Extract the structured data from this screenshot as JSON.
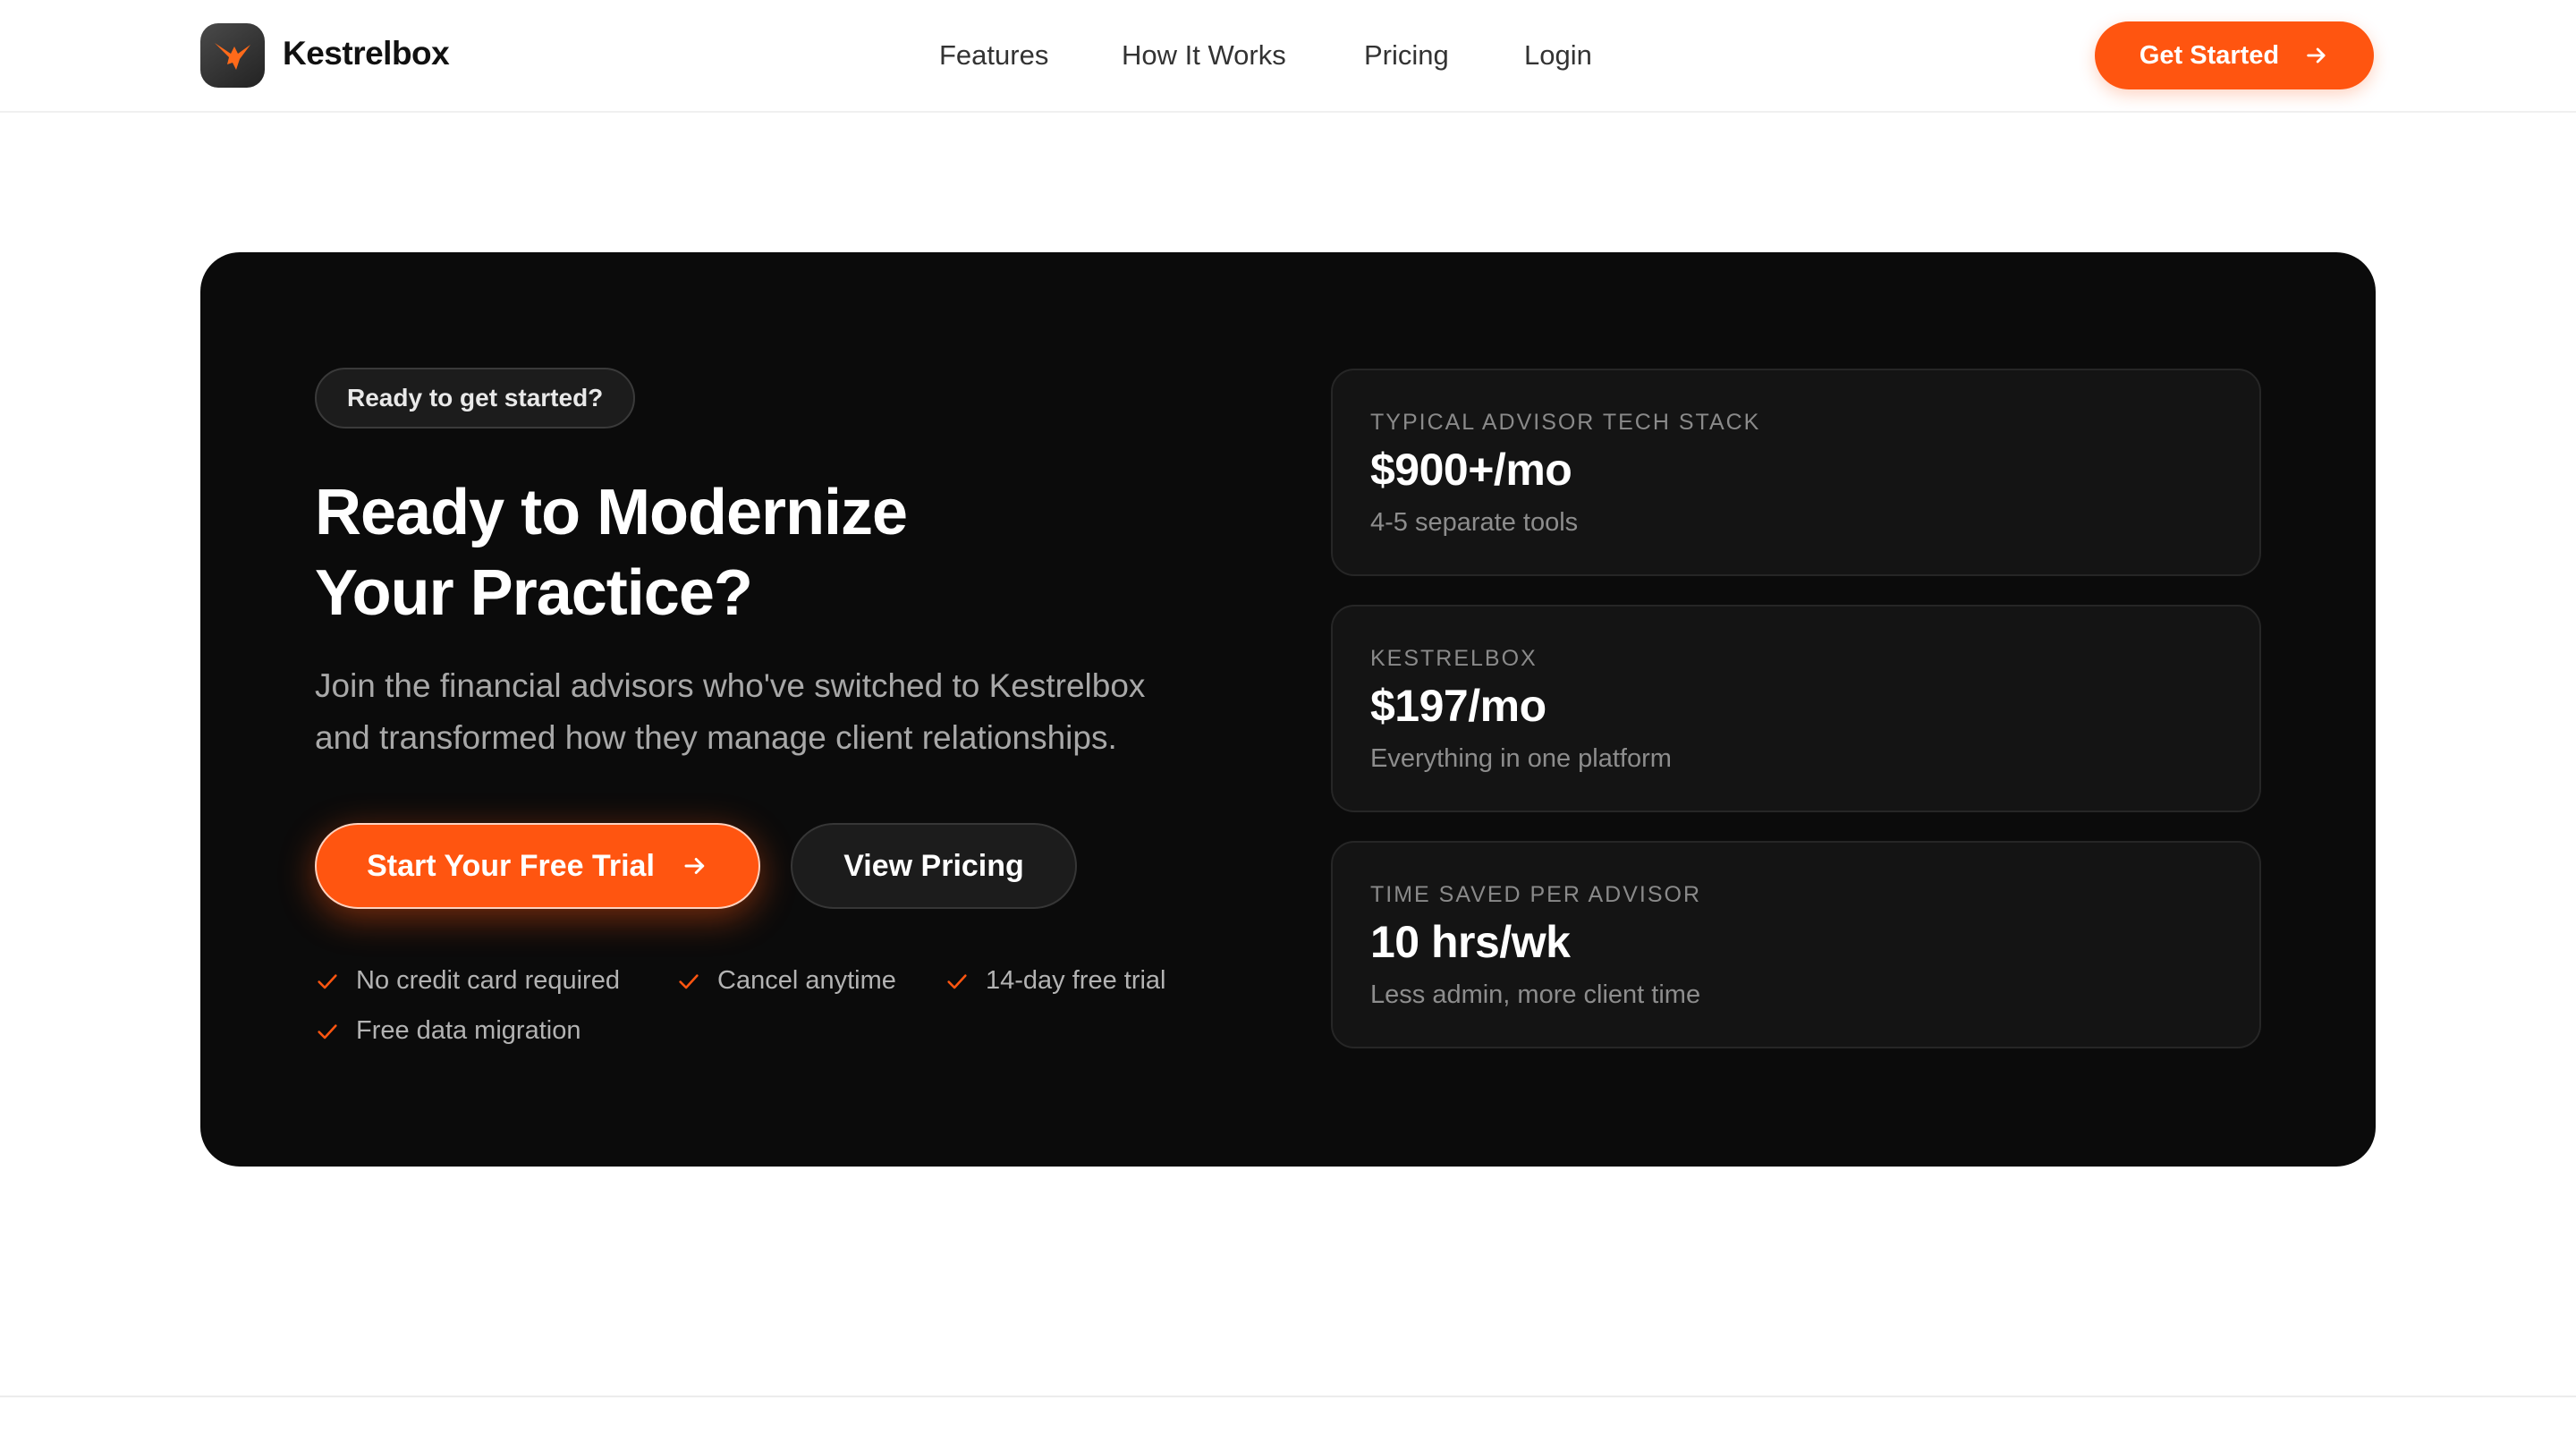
{
  "header": {
    "brand": "Kestrelbox",
    "nav": [
      "Features",
      "How It Works",
      "Pricing",
      "Login"
    ],
    "cta_label": "Get Started"
  },
  "hero": {
    "badge": "Ready to get started?",
    "title_line1": "Ready to Modernize",
    "title_line2": "Your Practice?",
    "subtitle_line1": "Join the financial advisors who've switched to Kestrelbox",
    "subtitle_line2": "and transformed how they manage client relationships.",
    "primary_cta": "Start Your Free Trial",
    "secondary_cta": "View Pricing",
    "checks": [
      "No credit card required",
      "Cancel anytime",
      "14-day free trial",
      "Free data migration"
    ]
  },
  "stats": [
    {
      "label": "TYPICAL ADVISOR TECH STACK",
      "value": "$900+/mo",
      "desc": "4-5 separate tools"
    },
    {
      "label": "KESTRELBOX",
      "value": "$197/mo",
      "desc": "Everything in one platform"
    },
    {
      "label": "TIME SAVED PER ADVISOR",
      "value": "10 hrs/wk",
      "desc": "Less admin, more client time"
    }
  ],
  "colors": {
    "accent": "#ff5510",
    "panel": "#0b0b0b",
    "card": "#141414"
  },
  "icons": [
    "kestrel-logo-icon",
    "arrow-right-icon",
    "check-icon"
  ]
}
